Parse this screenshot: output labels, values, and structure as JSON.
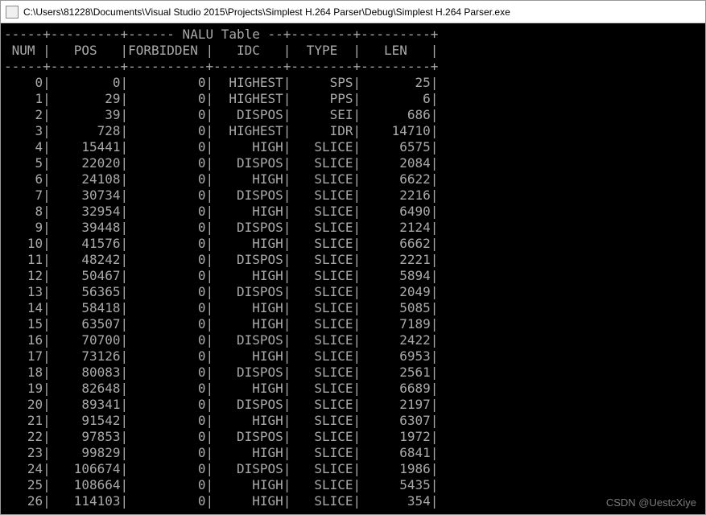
{
  "window": {
    "title": "C:\\Users\\81228\\Documents\\Visual Studio 2015\\Projects\\Simplest H.264 Parser\\Debug\\Simplest H.264 Parser.exe"
  },
  "table": {
    "caption": "NALU Table",
    "headers": [
      "NUM",
      "POS",
      "FORBIDDEN",
      "IDC",
      "TYPE",
      "LEN"
    ],
    "rows": [
      {
        "num": 0,
        "pos": 0,
        "forbidden": 0,
        "idc": "HIGHEST",
        "type": "SPS",
        "len": 25
      },
      {
        "num": 1,
        "pos": 29,
        "forbidden": 0,
        "idc": "HIGHEST",
        "type": "PPS",
        "len": 6
      },
      {
        "num": 2,
        "pos": 39,
        "forbidden": 0,
        "idc": "DISPOS",
        "type": "SEI",
        "len": 686
      },
      {
        "num": 3,
        "pos": 728,
        "forbidden": 0,
        "idc": "HIGHEST",
        "type": "IDR",
        "len": 14710
      },
      {
        "num": 4,
        "pos": 15441,
        "forbidden": 0,
        "idc": "HIGH",
        "type": "SLICE",
        "len": 6575
      },
      {
        "num": 5,
        "pos": 22020,
        "forbidden": 0,
        "idc": "DISPOS",
        "type": "SLICE",
        "len": 2084
      },
      {
        "num": 6,
        "pos": 24108,
        "forbidden": 0,
        "idc": "HIGH",
        "type": "SLICE",
        "len": 6622
      },
      {
        "num": 7,
        "pos": 30734,
        "forbidden": 0,
        "idc": "DISPOS",
        "type": "SLICE",
        "len": 2216
      },
      {
        "num": 8,
        "pos": 32954,
        "forbidden": 0,
        "idc": "HIGH",
        "type": "SLICE",
        "len": 6490
      },
      {
        "num": 9,
        "pos": 39448,
        "forbidden": 0,
        "idc": "DISPOS",
        "type": "SLICE",
        "len": 2124
      },
      {
        "num": 10,
        "pos": 41576,
        "forbidden": 0,
        "idc": "HIGH",
        "type": "SLICE",
        "len": 6662
      },
      {
        "num": 11,
        "pos": 48242,
        "forbidden": 0,
        "idc": "DISPOS",
        "type": "SLICE",
        "len": 2221
      },
      {
        "num": 12,
        "pos": 50467,
        "forbidden": 0,
        "idc": "HIGH",
        "type": "SLICE",
        "len": 5894
      },
      {
        "num": 13,
        "pos": 56365,
        "forbidden": 0,
        "idc": "DISPOS",
        "type": "SLICE",
        "len": 2049
      },
      {
        "num": 14,
        "pos": 58418,
        "forbidden": 0,
        "idc": "HIGH",
        "type": "SLICE",
        "len": 5085
      },
      {
        "num": 15,
        "pos": 63507,
        "forbidden": 0,
        "idc": "HIGH",
        "type": "SLICE",
        "len": 7189
      },
      {
        "num": 16,
        "pos": 70700,
        "forbidden": 0,
        "idc": "DISPOS",
        "type": "SLICE",
        "len": 2422
      },
      {
        "num": 17,
        "pos": 73126,
        "forbidden": 0,
        "idc": "HIGH",
        "type": "SLICE",
        "len": 6953
      },
      {
        "num": 18,
        "pos": 80083,
        "forbidden": 0,
        "idc": "DISPOS",
        "type": "SLICE",
        "len": 2561
      },
      {
        "num": 19,
        "pos": 82648,
        "forbidden": 0,
        "idc": "HIGH",
        "type": "SLICE",
        "len": 6689
      },
      {
        "num": 20,
        "pos": 89341,
        "forbidden": 0,
        "idc": "DISPOS",
        "type": "SLICE",
        "len": 2197
      },
      {
        "num": 21,
        "pos": 91542,
        "forbidden": 0,
        "idc": "HIGH",
        "type": "SLICE",
        "len": 6307
      },
      {
        "num": 22,
        "pos": 97853,
        "forbidden": 0,
        "idc": "DISPOS",
        "type": "SLICE",
        "len": 1972
      },
      {
        "num": 23,
        "pos": 99829,
        "forbidden": 0,
        "idc": "HIGH",
        "type": "SLICE",
        "len": 6841
      },
      {
        "num": 24,
        "pos": 106674,
        "forbidden": 0,
        "idc": "DISPOS",
        "type": "SLICE",
        "len": 1986
      },
      {
        "num": 25,
        "pos": 108664,
        "forbidden": 0,
        "idc": "HIGH",
        "type": "SLICE",
        "len": 5435
      },
      {
        "num": 26,
        "pos": 114103,
        "forbidden": 0,
        "idc": "HIGH",
        "type": "SLICE",
        "len": 354
      }
    ]
  },
  "watermark": "CSDN @UestcXiye",
  "widths": {
    "num": 5,
    "pos": 9,
    "forbidden": 10,
    "idc": 9,
    "type": 8,
    "len": 9
  }
}
